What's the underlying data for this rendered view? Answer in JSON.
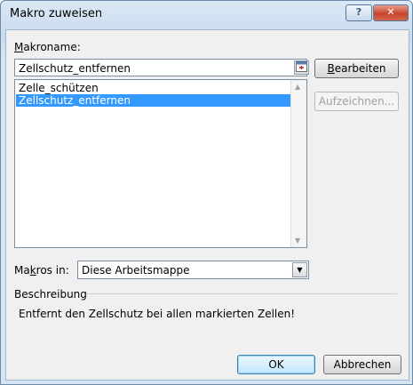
{
  "window": {
    "title": "Makro zuweisen",
    "help_label": "?",
    "close_label": "✕"
  },
  "macro_name": {
    "label_prefix": "",
    "label_accel": "M",
    "label_rest": "akroname:",
    "value": "Zellschutz_entfernen"
  },
  "macro_list": {
    "items": [
      {
        "label": "Zelle_schützen",
        "selected": false
      },
      {
        "label": "Zellschutz_entfernen",
        "selected": true
      }
    ]
  },
  "buttons": {
    "edit": {
      "accel": "B",
      "rest": "earbeiten"
    },
    "record": "Aufzeichnen...",
    "ok": "OK",
    "cancel": "Abbrechen"
  },
  "macros_in": {
    "label_prefix": "Ma",
    "label_accel": "k",
    "label_rest": "ros in:",
    "value": "Diese Arbeitsmappe"
  },
  "description": {
    "heading": "Beschreibung",
    "text": "Entfernt den Zellschutz bei allen markierten Zellen!"
  },
  "icons": {
    "collapse": "collapse-dialog-icon",
    "dropdown": "chevron-down-icon",
    "scroll_up": "scroll-up-icon",
    "scroll_down": "scroll-down-icon"
  }
}
